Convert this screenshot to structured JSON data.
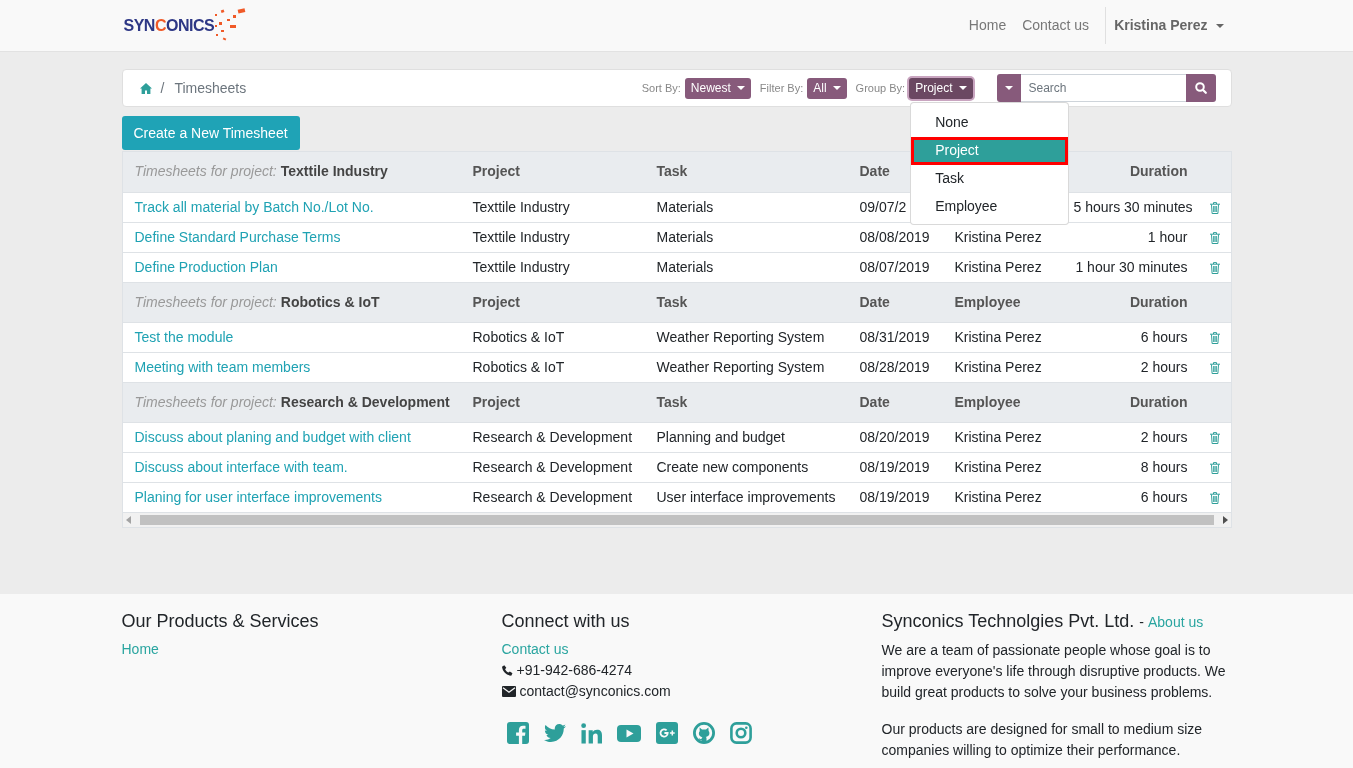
{
  "header": {
    "logo": {
      "before": "SYN",
      "accent": "C",
      "after": "ONICS"
    },
    "nav": [
      {
        "label": "Home"
      },
      {
        "label": "Contact us"
      }
    ],
    "user": {
      "name": "Kristina Perez"
    }
  },
  "breadcrumb": {
    "separator": "/",
    "current": "Timesheets"
  },
  "toolbar": {
    "sort": {
      "label": "Sort By:",
      "value": "Newest"
    },
    "filter": {
      "label": "Filter By:",
      "value": "All"
    },
    "group": {
      "label": "Group By:",
      "value": "Project",
      "expanded": true,
      "options": [
        {
          "label": "None",
          "selected": false
        },
        {
          "label": "Project",
          "selected": true
        },
        {
          "label": "Task",
          "selected": false
        },
        {
          "label": "Employee",
          "selected": false
        }
      ]
    },
    "search": {
      "placeholder": "Search"
    }
  },
  "create_button": "Create a New Timesheet",
  "table": {
    "groups": [
      {
        "label": "Timesheets for project:",
        "name": "Texttile Industry",
        "headings": {
          "project": "Project",
          "task": "Task",
          "date": "Date",
          "duration": "Duration"
        },
        "rows": [
          {
            "title": "Track all material by Batch No./Lot No.",
            "project": "Texttile Industry",
            "task": "Materials",
            "date": "09/07/2",
            "duration": "5 hours 30 minutes"
          },
          {
            "title": "Define Standard Purchase Terms",
            "project": "Texttile Industry",
            "task": "Materials",
            "date": "08/08/2019",
            "employee": "Kristina Perez",
            "duration": "1 hour"
          },
          {
            "title": "Define Production Plan",
            "project": "Texttile Industry",
            "task": "Materials",
            "date": "08/07/2019",
            "employee": "Kristina Perez",
            "duration": "1 hour 30 minutes"
          }
        ]
      },
      {
        "label": "Timesheets for project:",
        "name": "Robotics & IoT",
        "headings": {
          "project": "Project",
          "task": "Task",
          "date": "Date",
          "employee": "Employee",
          "duration": "Duration"
        },
        "rows": [
          {
            "title": "Test the module",
            "project": "Robotics & IoT",
            "task": "Weather Reporting System",
            "date": "08/31/2019",
            "employee": "Kristina Perez",
            "duration": "6 hours"
          },
          {
            "title": "Meeting with team members",
            "project": "Robotics & IoT",
            "task": "Weather Reporting System",
            "date": "08/28/2019",
            "employee": "Kristina Perez",
            "duration": "2 hours"
          }
        ]
      },
      {
        "label": "Timesheets for project:",
        "name": "Research & Development",
        "headings": {
          "project": "Project",
          "task": "Task",
          "date": "Date",
          "employee": "Employee",
          "duration": "Duration"
        },
        "rows": [
          {
            "title": "Discuss about planing and budget with client",
            "project": "Research & Development",
            "task": "Planning and budget",
            "date": "08/20/2019",
            "employee": "Kristina Perez",
            "duration": "2 hours"
          },
          {
            "title": "Discuss about interface with team.",
            "project": "Research & Development",
            "task": "Create new components",
            "date": "08/19/2019",
            "employee": "Kristina Perez",
            "duration": "8 hours"
          },
          {
            "title": "Planing for user interface improvements",
            "project": "Research & Development",
            "task": "User interface improvements",
            "date": "08/19/2019",
            "employee": "Kristina Perez",
            "duration": "6 hours"
          }
        ]
      }
    ]
  },
  "footer": {
    "products": {
      "heading": "Our Products & Services",
      "links": [
        "Home"
      ]
    },
    "connect": {
      "heading": "Connect with us",
      "link": "Contact us",
      "phone": "+91-942-686-4274",
      "email": "contact@synconics.com"
    },
    "company": {
      "heading": "Synconics Technolgies Pvt. Ltd.",
      "separator": "-",
      "link": "About us",
      "paragraphs": [
        "We are a team of passionate people whose goal is to improve everyone's life through disruptive products. We build great products to solve your business problems.",
        "Our products are designed for small to medium size companies willing to optimize their performance."
      ]
    }
  }
}
